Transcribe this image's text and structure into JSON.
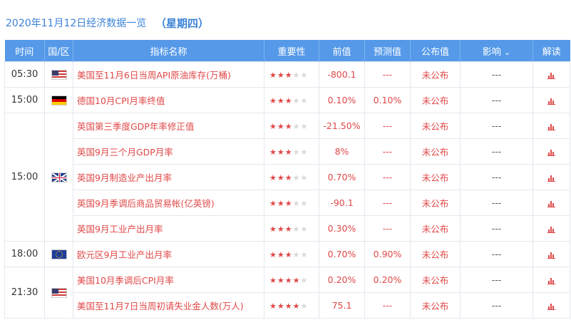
{
  "title": {
    "date": "2020年11月12日经济数据一览",
    "weekday": "（星期四）"
  },
  "headers": {
    "time": "时间",
    "region": "国/区",
    "indicator": "指标名称",
    "importance": "重要性",
    "previous": "前值",
    "forecast": "预测值",
    "actual": "公布值",
    "impact": "影响",
    "analysis": "解读"
  },
  "icons": {
    "impact_toggle": "chevron-down-icon",
    "analysis": "bar-chart-icon",
    "importance": "star-icon"
  },
  "colors": {
    "header_bg": "#5599e8",
    "accent_red": "#e04848",
    "title_blue": "#3b82d6"
  },
  "groups": [
    {
      "time": "05:30",
      "flag": "us",
      "rows": [
        {
          "name": "美国至11月6日当周API原油库存(万桶)",
          "stars": 3,
          "previous": "-800.1",
          "forecast": "---",
          "actual": "未公布",
          "impact": "---"
        }
      ]
    },
    {
      "time": "15:00",
      "flag": "de",
      "rows": [
        {
          "name": "德国10月CPI月率终值",
          "stars": 3,
          "previous": "0.10%",
          "forecast": "0.10%",
          "actual": "未公布",
          "impact": "---"
        }
      ]
    },
    {
      "time": "15:00",
      "flag": "gb",
      "rows": [
        {
          "name": "英国第三季度GDP年率修正值",
          "stars": 3,
          "previous": "-21.50%",
          "forecast": "---",
          "actual": "未公布",
          "impact": "---"
        },
        {
          "name": "英国9月三个月GDP月率",
          "stars": 3,
          "previous": "8%",
          "forecast": "---",
          "actual": "未公布",
          "impact": "---"
        },
        {
          "name": "英国9月制造业产出月率",
          "stars": 3,
          "previous": "0.70%",
          "forecast": "---",
          "actual": "未公布",
          "impact": "---"
        },
        {
          "name": "英国9月季调后商品贸易帐(亿英镑)",
          "stars": 3,
          "previous": "-90.1",
          "forecast": "---",
          "actual": "未公布",
          "impact": "---"
        },
        {
          "name": "英国9月工业产出月率",
          "stars": 3,
          "previous": "0.30%",
          "forecast": "---",
          "actual": "未公布",
          "impact": "---"
        }
      ]
    },
    {
      "time": "18:00",
      "flag": "eu",
      "rows": [
        {
          "name": "欧元区9月工业产出月率",
          "stars": 3,
          "previous": "0.70%",
          "forecast": "0.90%",
          "actual": "未公布",
          "impact": "---"
        }
      ]
    },
    {
      "time": "21:30",
      "flag": "us",
      "rows": [
        {
          "name": "美国10月季调后CPI月率",
          "stars": 4,
          "previous": "0.20%",
          "forecast": "0.20%",
          "actual": "未公布",
          "impact": "---"
        },
        {
          "name": "美国至11月7日当周初请失业金人数(万人)",
          "stars": 4,
          "previous": "75.1",
          "forecast": "---",
          "actual": "未公布",
          "impact": "---"
        }
      ]
    }
  ]
}
